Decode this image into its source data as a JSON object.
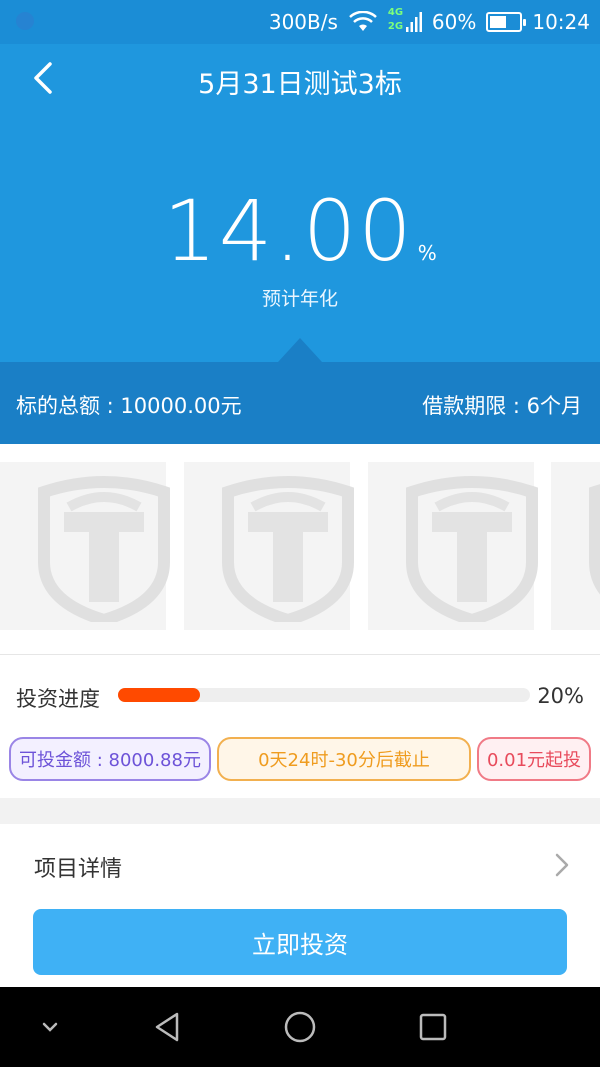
{
  "status_bar": {
    "speed": "300B/s",
    "network_4g": "4G",
    "network_2g": "2G",
    "battery_percent": "60%",
    "battery_level": 0.6,
    "time": "10:24"
  },
  "header": {
    "title": "5月31日测试3标",
    "annual_rate_value": "14.00",
    "annual_rate_unit": "%",
    "annual_rate_label": "预计年化"
  },
  "info_bar": {
    "total_amount": "标的总额 : 10000.00元",
    "loan_term": "借款期限 : 6个月"
  },
  "progress": {
    "label": "投资进度",
    "percent_text": "20%",
    "value": 0.2
  },
  "tags": {
    "available": "可投金额 : 8000.88元",
    "deadline": "0天24时-30分后截止",
    "min_invest": "0.01元起投"
  },
  "detail": {
    "label": "项目详情"
  },
  "cta": {
    "label": "立即投资"
  },
  "icons": {
    "back": "back-arrow-icon",
    "wifi": "wifi-icon",
    "signal": "signal-icon",
    "battery": "battery-icon",
    "chevron": "chevron-right-icon",
    "logo": "shield-logo-icon",
    "nav_down": "chevron-down-icon",
    "nav_back": "triangle-back-icon",
    "nav_home": "circle-home-icon",
    "nav_recent": "square-recent-icon"
  },
  "colors": {
    "primary": "#1f97de",
    "primary_dark": "#1a7fc6",
    "progress": "#ff4a00",
    "cta": "#3fb1f5"
  }
}
